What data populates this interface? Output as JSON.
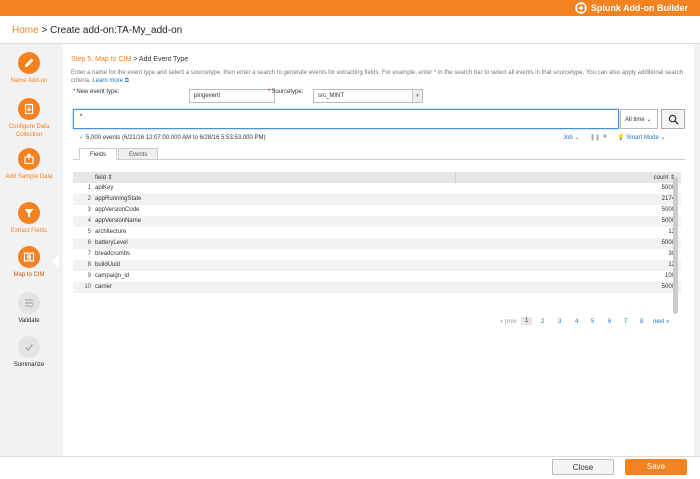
{
  "app": {
    "brand": "Splunk Add-on Builder",
    "accent": "#f58220"
  },
  "breadcrumb": {
    "home": "Home",
    "sep": " > ",
    "current": "Create add-on:TA-My_add-on"
  },
  "sidebar": {
    "steps": [
      {
        "label": "Name Add-on",
        "icon": "pencil-icon",
        "state": "done"
      },
      {
        "label": "Configure Data Collection",
        "icon": "data-collection-icon",
        "state": "done"
      },
      {
        "label": "Add Sample Data",
        "icon": "upload-icon",
        "state": "done"
      },
      {
        "label": "Extract Fields",
        "icon": "funnel-icon",
        "state": "done"
      },
      {
        "label": "Map to CIM",
        "icon": "map-cim-icon",
        "state": "active"
      },
      {
        "label": "Validate",
        "icon": "validate-icon",
        "state": "todo"
      },
      {
        "label": "Summarize",
        "icon": "checkmark-icon",
        "state": "todo"
      }
    ]
  },
  "main": {
    "step_prefix": "Step 5: Map to CIM",
    "step_suffix": " > Add Event Type",
    "description": "Enter a name for the event type and select a sourcetype, then enter a search to generate events for extracting fields. For example, enter * in the search bar to select all events in that sourcetype. You can also apply additional search criteria.",
    "learn_more": "Learn more",
    "event_type": {
      "label": "New event type:",
      "value": "pingevent"
    },
    "sourcetype": {
      "label": "Sourcetype:",
      "value": "src_MINT"
    },
    "search": {
      "value": "*",
      "time_range": "All time",
      "time_caret": "⌄"
    },
    "status": "5,000 events (6/21/16 12:07:00.000 AM to 6/28/16 5:53:53.000 PM)",
    "job_label": "Job",
    "smart_mode": "Smart Mode",
    "tabs": [
      "Fields",
      "Events"
    ],
    "table": {
      "columns": [
        "field",
        "count"
      ],
      "rows": [
        {
          "n": "1",
          "field": "apiKey",
          "count": "5000"
        },
        {
          "n": "2",
          "field": "appRunningState",
          "count": "2174"
        },
        {
          "n": "3",
          "field": "appVersionCode",
          "count": "5000"
        },
        {
          "n": "4",
          "field": "appVersionName",
          "count": "5000"
        },
        {
          "n": "5",
          "field": "architecture",
          "count": "12"
        },
        {
          "n": "6",
          "field": "batteryLevel",
          "count": "5000"
        },
        {
          "n": "7",
          "field": "breadcrumbs",
          "count": "30"
        },
        {
          "n": "8",
          "field": "buildUuid",
          "count": "12"
        },
        {
          "n": "9",
          "field": "campaign_id",
          "count": "100"
        },
        {
          "n": "10",
          "field": "carrier",
          "count": "5000"
        }
      ]
    },
    "pager": {
      "prev": "« prev",
      "pages": [
        "1",
        "2",
        "3",
        "4",
        "5",
        "6",
        "7",
        "8"
      ],
      "next": "next »",
      "current": "1"
    }
  },
  "footer": {
    "close": "Close",
    "save": "Save"
  }
}
